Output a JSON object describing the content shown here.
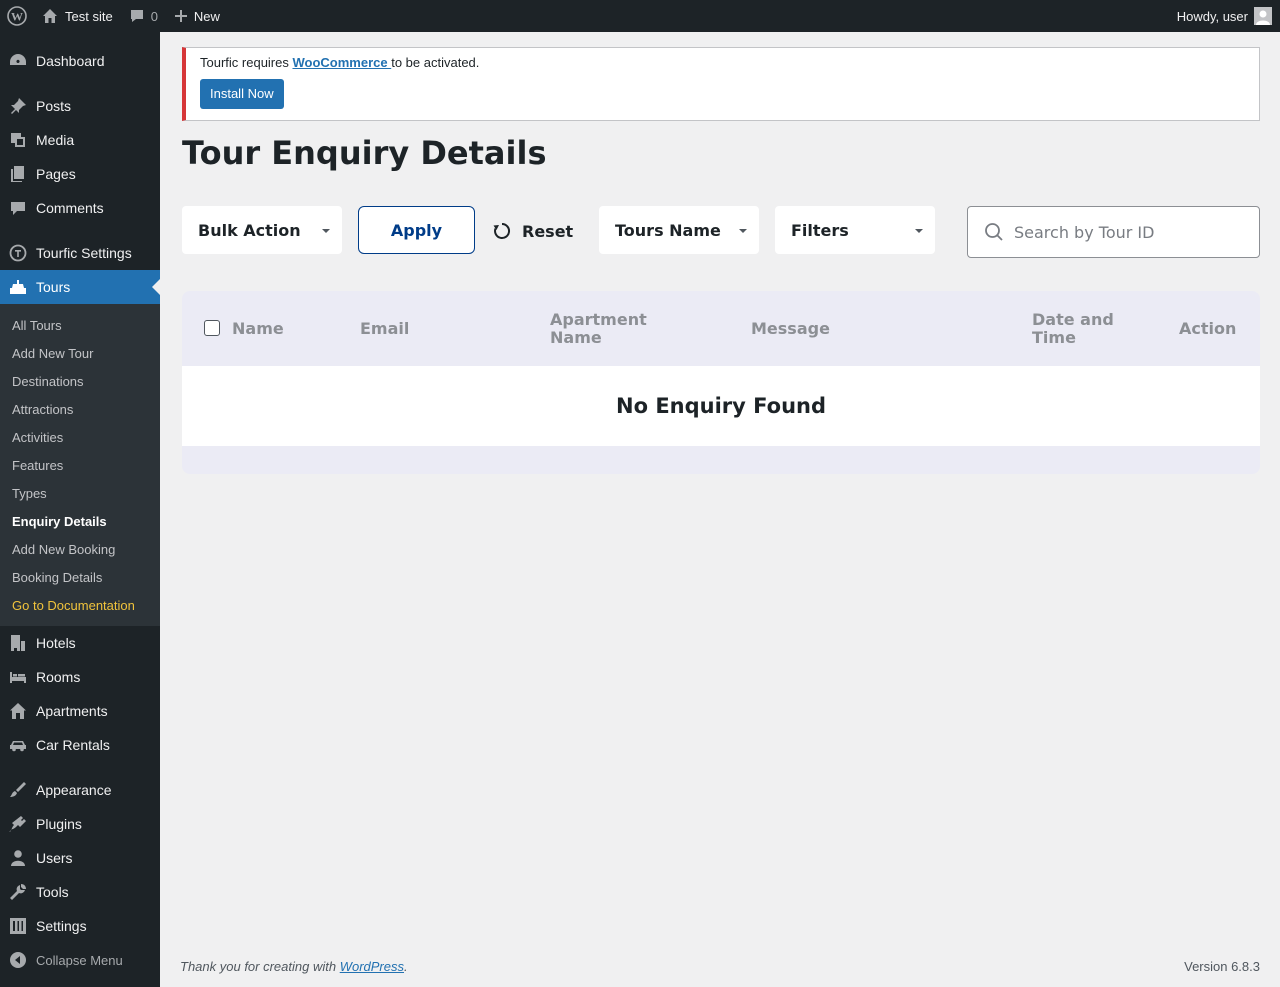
{
  "adminbar": {
    "site_name": "Test site",
    "comments_count": "0",
    "new_label": "New",
    "greeting": "Howdy, user"
  },
  "sidebar": {
    "items": [
      {
        "label": "Dashboard",
        "icon": "dashboard-icon"
      },
      {
        "label": "Posts",
        "icon": "pin-icon"
      },
      {
        "label": "Media",
        "icon": "media-icon"
      },
      {
        "label": "Pages",
        "icon": "pages-icon"
      },
      {
        "label": "Comments",
        "icon": "comment-icon"
      },
      {
        "label": "Tourfic Settings",
        "icon": "tourfic-icon"
      },
      {
        "label": "Tours",
        "icon": "tours-icon"
      },
      {
        "label": "Hotels",
        "icon": "building-icon"
      },
      {
        "label": "Rooms",
        "icon": "bed-icon"
      },
      {
        "label": "Apartments",
        "icon": "home-icon"
      },
      {
        "label": "Car Rentals",
        "icon": "car-icon"
      },
      {
        "label": "Appearance",
        "icon": "brush-icon"
      },
      {
        "label": "Plugins",
        "icon": "plugin-icon"
      },
      {
        "label": "Users",
        "icon": "user-icon"
      },
      {
        "label": "Tools",
        "icon": "wrench-icon"
      },
      {
        "label": "Settings",
        "icon": "sliders-icon"
      }
    ],
    "submenu": [
      "All Tours",
      "Add New Tour",
      "Destinations",
      "Attractions",
      "Activities",
      "Features",
      "Types",
      "Enquiry Details",
      "Add New Booking",
      "Booking Details",
      "Go to Documentation"
    ],
    "collapse_label": "Collapse Menu"
  },
  "notice": {
    "text_before": "Tourfic requires ",
    "link": "WooCommerce ",
    "text_after": "to be activated.",
    "button": "Install Now"
  },
  "page_title": "Tour Enquiry Details",
  "toolbar": {
    "bulk_action": "Bulk Action",
    "apply": "Apply",
    "reset": "Reset",
    "tours_name": "Tours Name",
    "filters": "Filters",
    "search_placeholder": "Search by Tour ID"
  },
  "table": {
    "columns": [
      "Name",
      "Email",
      "Apartment Name",
      "Message",
      "Date and Time",
      "Action"
    ],
    "empty_message": "No Enquiry Found"
  },
  "footer": {
    "thanks_prefix": "Thank you for creating with ",
    "wordpress_link": "WordPress",
    "thanks_suffix": ".",
    "version": "Version 6.8.3"
  }
}
